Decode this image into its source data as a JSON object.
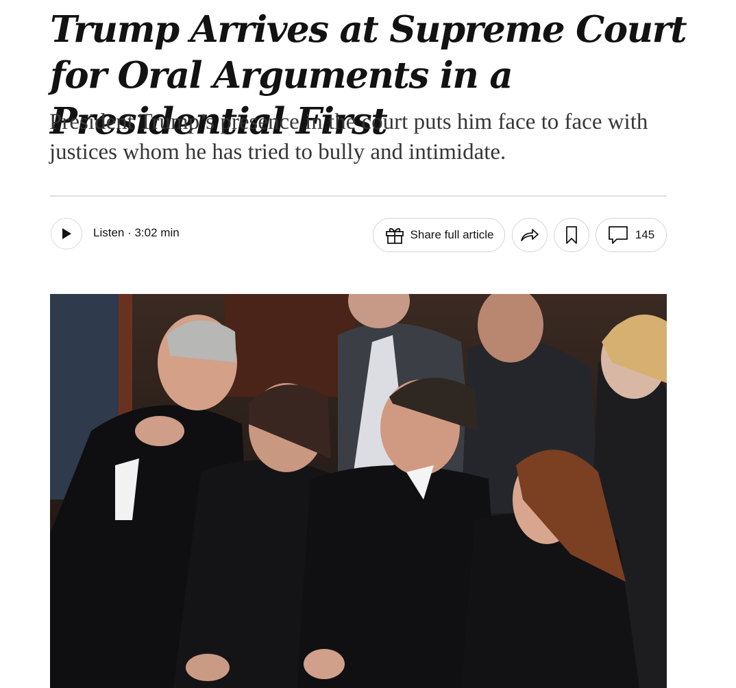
{
  "article": {
    "headline": "Trump Arrives at Supreme Court for Oral Arguments in a Presidential First",
    "summary": "President Trump’s presence in the court puts him face to face with justices whom he has tried to bully and intimidate."
  },
  "toolbar": {
    "listen_label": "Listen · 3:02 min",
    "share_full_label": "Share full article",
    "comment_count": "145",
    "icons": {
      "play": "play-icon",
      "gift": "gift-icon",
      "share": "share-arrow-icon",
      "save": "bookmark-icon",
      "comments": "speech-bubble-icon"
    }
  },
  "colors": {
    "text": "#121212",
    "dek": "#363636",
    "border": "#dcdcdc"
  }
}
